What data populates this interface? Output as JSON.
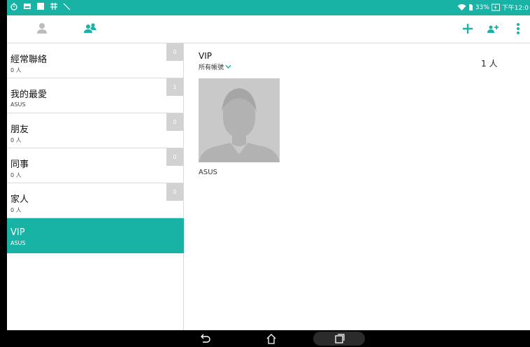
{
  "status_bar": {
    "battery": "33%",
    "time": "下午12:0",
    "left_icons": [
      "timer-icon",
      "image-icon",
      "square-icon",
      "grid-icon",
      "signal-icon"
    ],
    "right_icons": [
      "wifi-icon",
      "sim-icon",
      "battery-charging-icon"
    ]
  },
  "toolbar": {
    "tabs": [
      {
        "name": "contacts-tab",
        "icon": "person-icon",
        "active": false
      },
      {
        "name": "groups-tab",
        "icon": "group-icon",
        "active": true
      }
    ],
    "actions": [
      "add-icon",
      "add-group-icon",
      "more-icon"
    ]
  },
  "groups": [
    {
      "name": "經常聯絡",
      "sub": "0 人",
      "count": "0"
    },
    {
      "name": "我的最愛",
      "sub": "ASUS",
      "count": "1"
    },
    {
      "name": "朋友",
      "sub": "0 人",
      "count": "0"
    },
    {
      "name": "同事",
      "sub": "0 人",
      "count": "0"
    },
    {
      "name": "家人",
      "sub": "0 人",
      "count": "0"
    },
    {
      "name": "VIP",
      "sub": "ASUS",
      "selected": true
    }
  ],
  "detail": {
    "title": "VIP",
    "account_filter": "所有帳號",
    "member_count": "1 人",
    "contact_name": "ASUS"
  },
  "colors": {
    "accent": "#19b3a5",
    "badge": "#d2d2d2"
  }
}
